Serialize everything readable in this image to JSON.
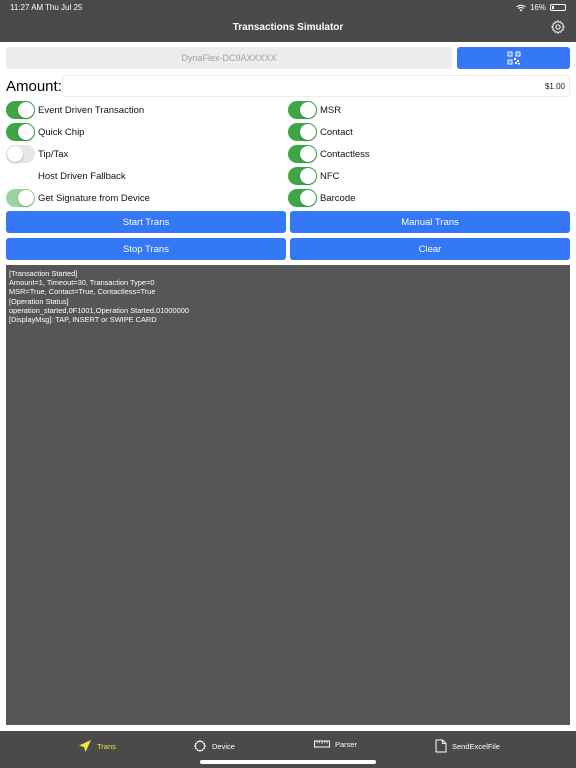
{
  "status_bar": {
    "time": "11:27 AM",
    "date": "Thu Jul 25",
    "battery": "16%",
    "battery_level": 0.16
  },
  "header": {
    "title": "Transactions Simulator"
  },
  "device": {
    "name": "DynaFlex-DC9AXXXXX"
  },
  "amount": {
    "label": "Amount:",
    "value": "$1.00"
  },
  "toggles_left": [
    {
      "label": "Event Driven Transaction",
      "on": true
    },
    {
      "label": "Quick Chip",
      "on": true
    },
    {
      "label": "Tip/Tax",
      "on": false
    },
    {
      "label": "Host Driven Fallback",
      "on": false
    },
    {
      "label": "Get Signature from Device",
      "on": true
    }
  ],
  "toggles_right": [
    {
      "label": "MSR",
      "on": true
    },
    {
      "label": "Contact",
      "on": true
    },
    {
      "label": "Contactless",
      "on": true
    },
    {
      "label": "NFC",
      "on": true
    },
    {
      "label": "Barcode",
      "on": true
    }
  ],
  "buttons": {
    "start_trans": "Start Trans",
    "manual_trans": "Manual Trans",
    "stop_trans": "Stop Trans",
    "clear": "Clear"
  },
  "log": {
    "text": "[Transaction Started]\nAmount=1, Timeout=30, Transaction Type=0\nMSR=True, Contact=True, Contactless=True\n[Operation Status]\noperation_started,0F1001,Operation Started,01000000\n[DisplayMsg]: TAP, INSERT or SWIPE CARD"
  },
  "tabs": [
    {
      "label": "Trans",
      "icon": "paper-plane-icon",
      "active": true
    },
    {
      "label": "Device",
      "icon": "gear-outline-icon",
      "active": false
    },
    {
      "label": "Parser",
      "icon": "ruler-icon",
      "active": false
    },
    {
      "label": "SendExcelFile",
      "icon": "document-icon",
      "active": false
    }
  ],
  "colors": {
    "accent": "#3478f6",
    "toggle_on": "#3ea645",
    "bar": "#4a4a4a",
    "active_tab": "#f0e642"
  }
}
